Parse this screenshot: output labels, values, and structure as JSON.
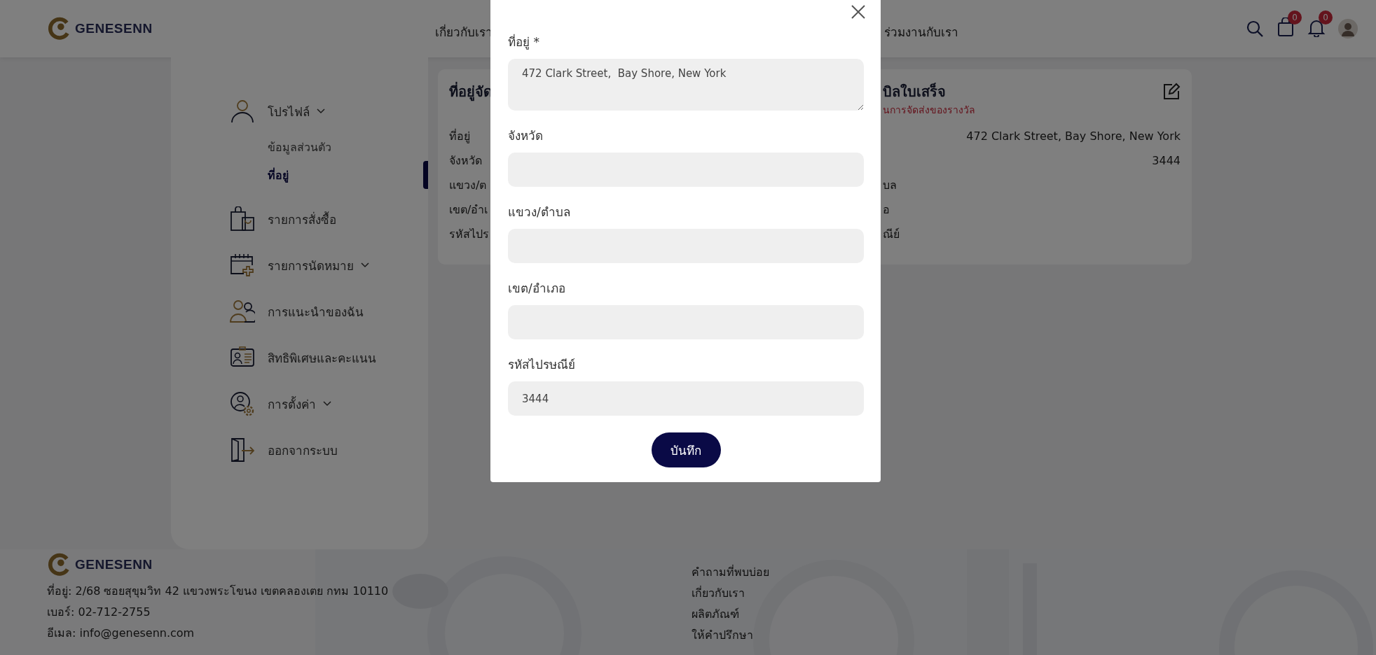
{
  "header": {
    "logo": "GENESENN",
    "nav": [
      "เกี่ยวกับเรา",
      "ร่วมงานกับเรา"
    ],
    "cart_badge": "0",
    "notification_badge": "0"
  },
  "sidebar": {
    "items": [
      {
        "kind": "user",
        "label": "โปรไฟล์",
        "dropdown": true,
        "children": [
          {
            "label": "ข้อมูลส่วนตัว",
            "selected": false
          },
          {
            "label": "ที่อยู่",
            "selected": true
          }
        ]
      },
      {
        "kind": "bag",
        "label": "รายการสั่งซื้อ",
        "dropdown": false
      },
      {
        "kind": "calendar",
        "label": "รายการนัดหมาย",
        "dropdown": true
      },
      {
        "kind": "referral",
        "label": "การแนะนำของฉัน",
        "dropdown": false
      },
      {
        "kind": "card",
        "label": "สิทธิพิเศษและคะแนน",
        "dropdown": false
      },
      {
        "kind": "settings",
        "label": "การตั้งค่า",
        "dropdown": true
      },
      {
        "kind": "logout",
        "label": "ออกจากระบบ",
        "dropdown": false
      }
    ]
  },
  "address_card": {
    "shipping": {
      "title": "ที่อยู่จัด",
      "rows": [
        "ที่อยู่",
        "จังหวัด",
        "แขวง/ต",
        "เขต/อำเ",
        "รหัสไปร"
      ]
    },
    "billing": {
      "title": "บิลใบเสร็จ",
      "note": "นการจัดส่งของรางวัล",
      "rows": [
        {
          "value": "472 Clark Street, Bay Shore, New York"
        },
        {
          "value": "3444"
        },
        {
          "label": "บล"
        },
        {
          "label": "อ"
        },
        {
          "label": "ณีย์"
        }
      ]
    }
  },
  "modal": {
    "fields": [
      {
        "kind": "textarea",
        "label": "ที่อยู่ *",
        "value": "472 Clark Street,  Bay Shore, New York"
      },
      {
        "kind": "input",
        "label": "จังหวัด"
      },
      {
        "kind": "input",
        "label": "แขวง/ตำบล"
      },
      {
        "kind": "input",
        "label": "เขต/อำเภอ"
      },
      {
        "kind": "input",
        "label": "รหัสไปรษณีย์",
        "value": "3444"
      }
    ],
    "save_button": "บันทึก"
  },
  "footer": {
    "logo": "GENESENN",
    "address": "ที่อยู่: 2/68 ซอยสุขุมวิท 42 แขวงพระโขนง เขตคลองเตย กทม 10110",
    "phone": "เบอร์: 02-712-2755",
    "email": "อีเมล: info@genesenn.com",
    "links": [
      "คำถามที่พบบ่อย",
      "เกี่ยวกับเรา",
      "ผลิตภัณฑ์",
      "ให้คำปรึกษา"
    ]
  }
}
